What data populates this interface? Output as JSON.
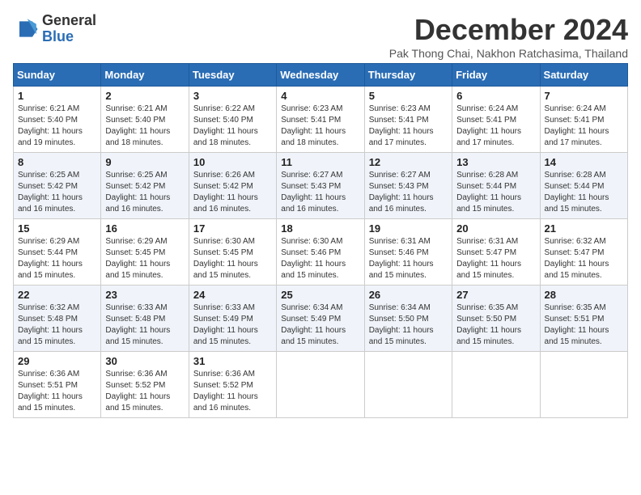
{
  "header": {
    "logo": {
      "line1": "General",
      "line2": "Blue"
    },
    "title": "December 2024",
    "subtitle": "Pak Thong Chai, Nakhon Ratchasima, Thailand"
  },
  "weekdays": [
    "Sunday",
    "Monday",
    "Tuesday",
    "Wednesday",
    "Thursday",
    "Friday",
    "Saturday"
  ],
  "weeks": [
    [
      {
        "day": "1",
        "sunrise": "6:21 AM",
        "sunset": "5:40 PM",
        "daylight": "11 hours and 19 minutes."
      },
      {
        "day": "2",
        "sunrise": "6:21 AM",
        "sunset": "5:40 PM",
        "daylight": "11 hours and 18 minutes."
      },
      {
        "day": "3",
        "sunrise": "6:22 AM",
        "sunset": "5:40 PM",
        "daylight": "11 hours and 18 minutes."
      },
      {
        "day": "4",
        "sunrise": "6:23 AM",
        "sunset": "5:41 PM",
        "daylight": "11 hours and 18 minutes."
      },
      {
        "day": "5",
        "sunrise": "6:23 AM",
        "sunset": "5:41 PM",
        "daylight": "11 hours and 17 minutes."
      },
      {
        "day": "6",
        "sunrise": "6:24 AM",
        "sunset": "5:41 PM",
        "daylight": "11 hours and 17 minutes."
      },
      {
        "day": "7",
        "sunrise": "6:24 AM",
        "sunset": "5:41 PM",
        "daylight": "11 hours and 17 minutes."
      }
    ],
    [
      {
        "day": "8",
        "sunrise": "6:25 AM",
        "sunset": "5:42 PM",
        "daylight": "11 hours and 16 minutes."
      },
      {
        "day": "9",
        "sunrise": "6:25 AM",
        "sunset": "5:42 PM",
        "daylight": "11 hours and 16 minutes."
      },
      {
        "day": "10",
        "sunrise": "6:26 AM",
        "sunset": "5:42 PM",
        "daylight": "11 hours and 16 minutes."
      },
      {
        "day": "11",
        "sunrise": "6:27 AM",
        "sunset": "5:43 PM",
        "daylight": "11 hours and 16 minutes."
      },
      {
        "day": "12",
        "sunrise": "6:27 AM",
        "sunset": "5:43 PM",
        "daylight": "11 hours and 16 minutes."
      },
      {
        "day": "13",
        "sunrise": "6:28 AM",
        "sunset": "5:44 PM",
        "daylight": "11 hours and 15 minutes."
      },
      {
        "day": "14",
        "sunrise": "6:28 AM",
        "sunset": "5:44 PM",
        "daylight": "11 hours and 15 minutes."
      }
    ],
    [
      {
        "day": "15",
        "sunrise": "6:29 AM",
        "sunset": "5:44 PM",
        "daylight": "11 hours and 15 minutes."
      },
      {
        "day": "16",
        "sunrise": "6:29 AM",
        "sunset": "5:45 PM",
        "daylight": "11 hours and 15 minutes."
      },
      {
        "day": "17",
        "sunrise": "6:30 AM",
        "sunset": "5:45 PM",
        "daylight": "11 hours and 15 minutes."
      },
      {
        "day": "18",
        "sunrise": "6:30 AM",
        "sunset": "5:46 PM",
        "daylight": "11 hours and 15 minutes."
      },
      {
        "day": "19",
        "sunrise": "6:31 AM",
        "sunset": "5:46 PM",
        "daylight": "11 hours and 15 minutes."
      },
      {
        "day": "20",
        "sunrise": "6:31 AM",
        "sunset": "5:47 PM",
        "daylight": "11 hours and 15 minutes."
      },
      {
        "day": "21",
        "sunrise": "6:32 AM",
        "sunset": "5:47 PM",
        "daylight": "11 hours and 15 minutes."
      }
    ],
    [
      {
        "day": "22",
        "sunrise": "6:32 AM",
        "sunset": "5:48 PM",
        "daylight": "11 hours and 15 minutes."
      },
      {
        "day": "23",
        "sunrise": "6:33 AM",
        "sunset": "5:48 PM",
        "daylight": "11 hours and 15 minutes."
      },
      {
        "day": "24",
        "sunrise": "6:33 AM",
        "sunset": "5:49 PM",
        "daylight": "11 hours and 15 minutes."
      },
      {
        "day": "25",
        "sunrise": "6:34 AM",
        "sunset": "5:49 PM",
        "daylight": "11 hours and 15 minutes."
      },
      {
        "day": "26",
        "sunrise": "6:34 AM",
        "sunset": "5:50 PM",
        "daylight": "11 hours and 15 minutes."
      },
      {
        "day": "27",
        "sunrise": "6:35 AM",
        "sunset": "5:50 PM",
        "daylight": "11 hours and 15 minutes."
      },
      {
        "day": "28",
        "sunrise": "6:35 AM",
        "sunset": "5:51 PM",
        "daylight": "11 hours and 15 minutes."
      }
    ],
    [
      {
        "day": "29",
        "sunrise": "6:36 AM",
        "sunset": "5:51 PM",
        "daylight": "11 hours and 15 minutes."
      },
      {
        "day": "30",
        "sunrise": "6:36 AM",
        "sunset": "5:52 PM",
        "daylight": "11 hours and 15 minutes."
      },
      {
        "day": "31",
        "sunrise": "6:36 AM",
        "sunset": "5:52 PM",
        "daylight": "11 hours and 16 minutes."
      },
      null,
      null,
      null,
      null
    ]
  ]
}
